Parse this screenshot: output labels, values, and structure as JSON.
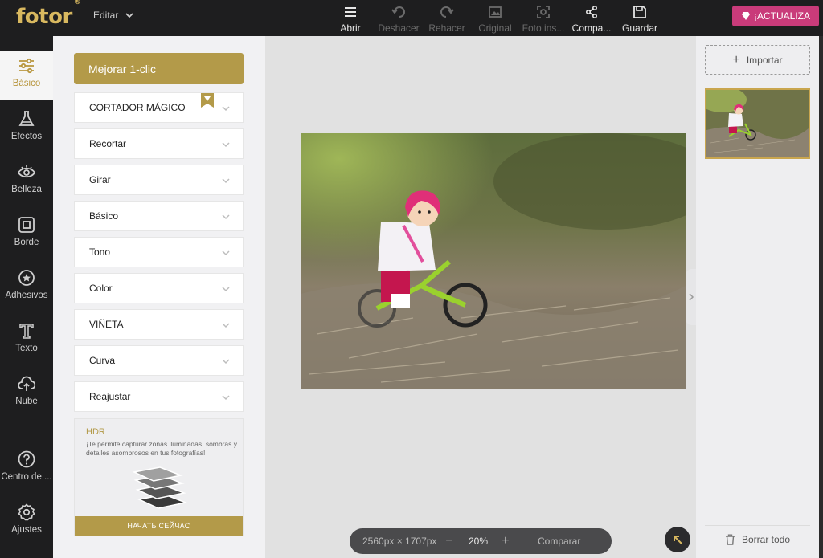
{
  "app": {
    "logo": "fotor",
    "logo_mark": "®",
    "mode_label": "Editar"
  },
  "toolbar": {
    "tools": [
      {
        "label": "Abrir",
        "icon": "menu-icon",
        "enabled": true
      },
      {
        "label": "Deshacer",
        "icon": "undo-icon",
        "enabled": false
      },
      {
        "label": "Rehacer",
        "icon": "redo-icon",
        "enabled": false
      },
      {
        "label": "Original",
        "icon": "image-icon",
        "enabled": false
      },
      {
        "label": "Foto ins...",
        "icon": "crop-scan-icon",
        "enabled": false
      },
      {
        "label": "Compa...",
        "icon": "share-icon",
        "enabled": true
      },
      {
        "label": "Guardar",
        "icon": "save-icon",
        "enabled": true
      }
    ],
    "upgrade_label": "¡ACTUALIZA"
  },
  "sidebar": {
    "items": [
      {
        "label": "Básico",
        "icon": "sliders-icon",
        "active": true
      },
      {
        "label": "Efectos",
        "icon": "flask-icon",
        "active": false
      },
      {
        "label": "Belleza",
        "icon": "eye-icon",
        "active": false
      },
      {
        "label": "Borde",
        "icon": "frame-icon",
        "active": false
      },
      {
        "label": "Adhesivos",
        "icon": "sticker-star-icon",
        "active": false
      },
      {
        "label": "Texto",
        "icon": "text-t-icon",
        "active": false
      },
      {
        "label": "Nube",
        "icon": "cloud-upload-icon",
        "active": false
      },
      {
        "label": "Centro de ...",
        "icon": "help-icon",
        "active": false
      },
      {
        "label": "Ajustes",
        "icon": "gear-icon",
        "active": false
      }
    ]
  },
  "panel": {
    "one_click_label": "Mejorar 1-clic",
    "sections": [
      "CORTADOR MÁGICO",
      "Recortar",
      "Girar",
      "Básico",
      "Tono",
      "Color",
      "VIÑETA",
      "Curva",
      "Reajustar"
    ],
    "hdr_promo": {
      "title": "HDR",
      "description": "¡Te permite capturar zonas iluminadas, sombras y detalles asombrosos en tus fotografías!",
      "button_label": "НАЧАТЬ СЕЙЧАС"
    }
  },
  "canvas": {
    "dimensions": "2560px × 1707px",
    "zoom_out": "−",
    "zoom_level": "20%",
    "zoom_in": "+",
    "compare_label": "Comparar"
  },
  "right_panel": {
    "import_label": "Importar",
    "clear_label": "Borrar todo"
  },
  "colors": {
    "accent_gold": "#b39a49",
    "upgrade_pink": "#c93b7a",
    "dark_bar": "#1e1e1f"
  }
}
